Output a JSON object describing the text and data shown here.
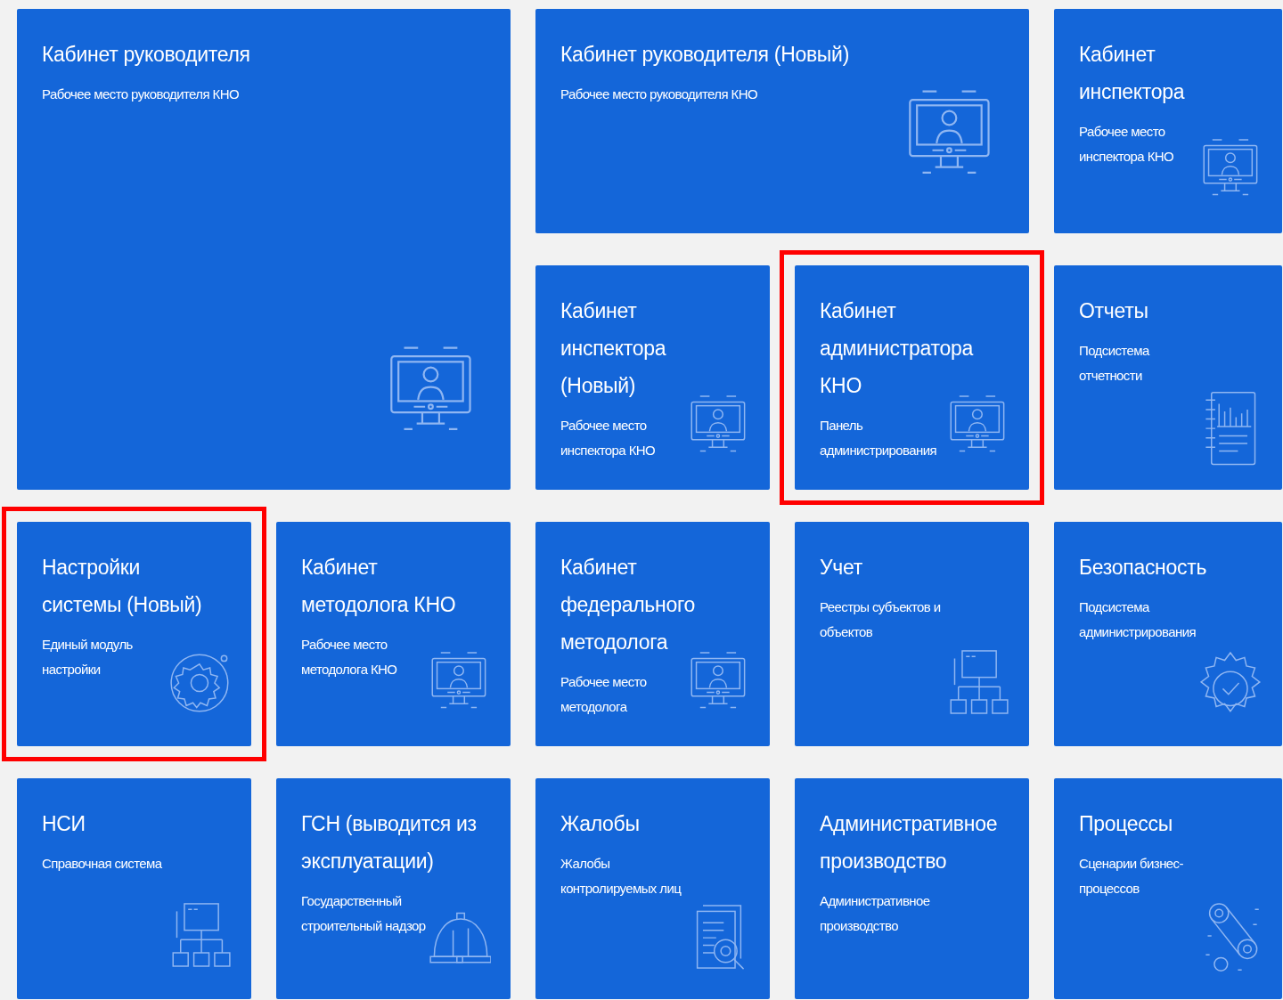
{
  "tiles": [
    {
      "title": "Кабинет руководителя",
      "subtitle": "Рабочее место руководителя КНО",
      "highlighted": false
    },
    {
      "title": "Кабинет руководителя (Новый)",
      "subtitle": "Рабочее место руководителя КНО",
      "highlighted": false
    },
    {
      "title": "Кабинет инспектора",
      "subtitle": "Рабочее место инспектора КНО",
      "highlighted": false
    },
    {
      "title": "Кабинет инспектора (Новый)",
      "subtitle": "Рабочее место инспектора КНО",
      "highlighted": false
    },
    {
      "title": "Кабинет администратора КНО",
      "subtitle": "Панель администрирования",
      "highlighted": true
    },
    {
      "title": "Отчеты",
      "subtitle": "Подсистема отчетности",
      "highlighted": false
    },
    {
      "title": "Настройки системы (Новый)",
      "subtitle": "Единый модуль настройки",
      "highlighted": true
    },
    {
      "title": "Кабинет методолога КНО",
      "subtitle": "Рабочее место методолога КНО",
      "highlighted": false
    },
    {
      "title": "Кабинет федерального методолога",
      "subtitle": "Рабочее место методолога",
      "highlighted": false
    },
    {
      "title": "Учет",
      "subtitle": "Реестры субъектов и объектов",
      "highlighted": false
    },
    {
      "title": "Безопасность",
      "subtitle": "Подсистема администрирования",
      "highlighted": false
    },
    {
      "title": "НСИ",
      "subtitle": "Справочная система",
      "highlighted": false
    },
    {
      "title": "ГСН (выводится из эксплуатации)",
      "subtitle": "Государственный строительный надзор",
      "highlighted": false
    },
    {
      "title": "Жалобы",
      "subtitle": "Жалобы контролируемых лиц",
      "highlighted": false
    },
    {
      "title": "Административное производство",
      "subtitle": "Административное производство",
      "highlighted": false
    },
    {
      "title": "Процессы",
      "subtitle": "Сценарии бизнес-процессов",
      "highlighted": false
    }
  ]
}
